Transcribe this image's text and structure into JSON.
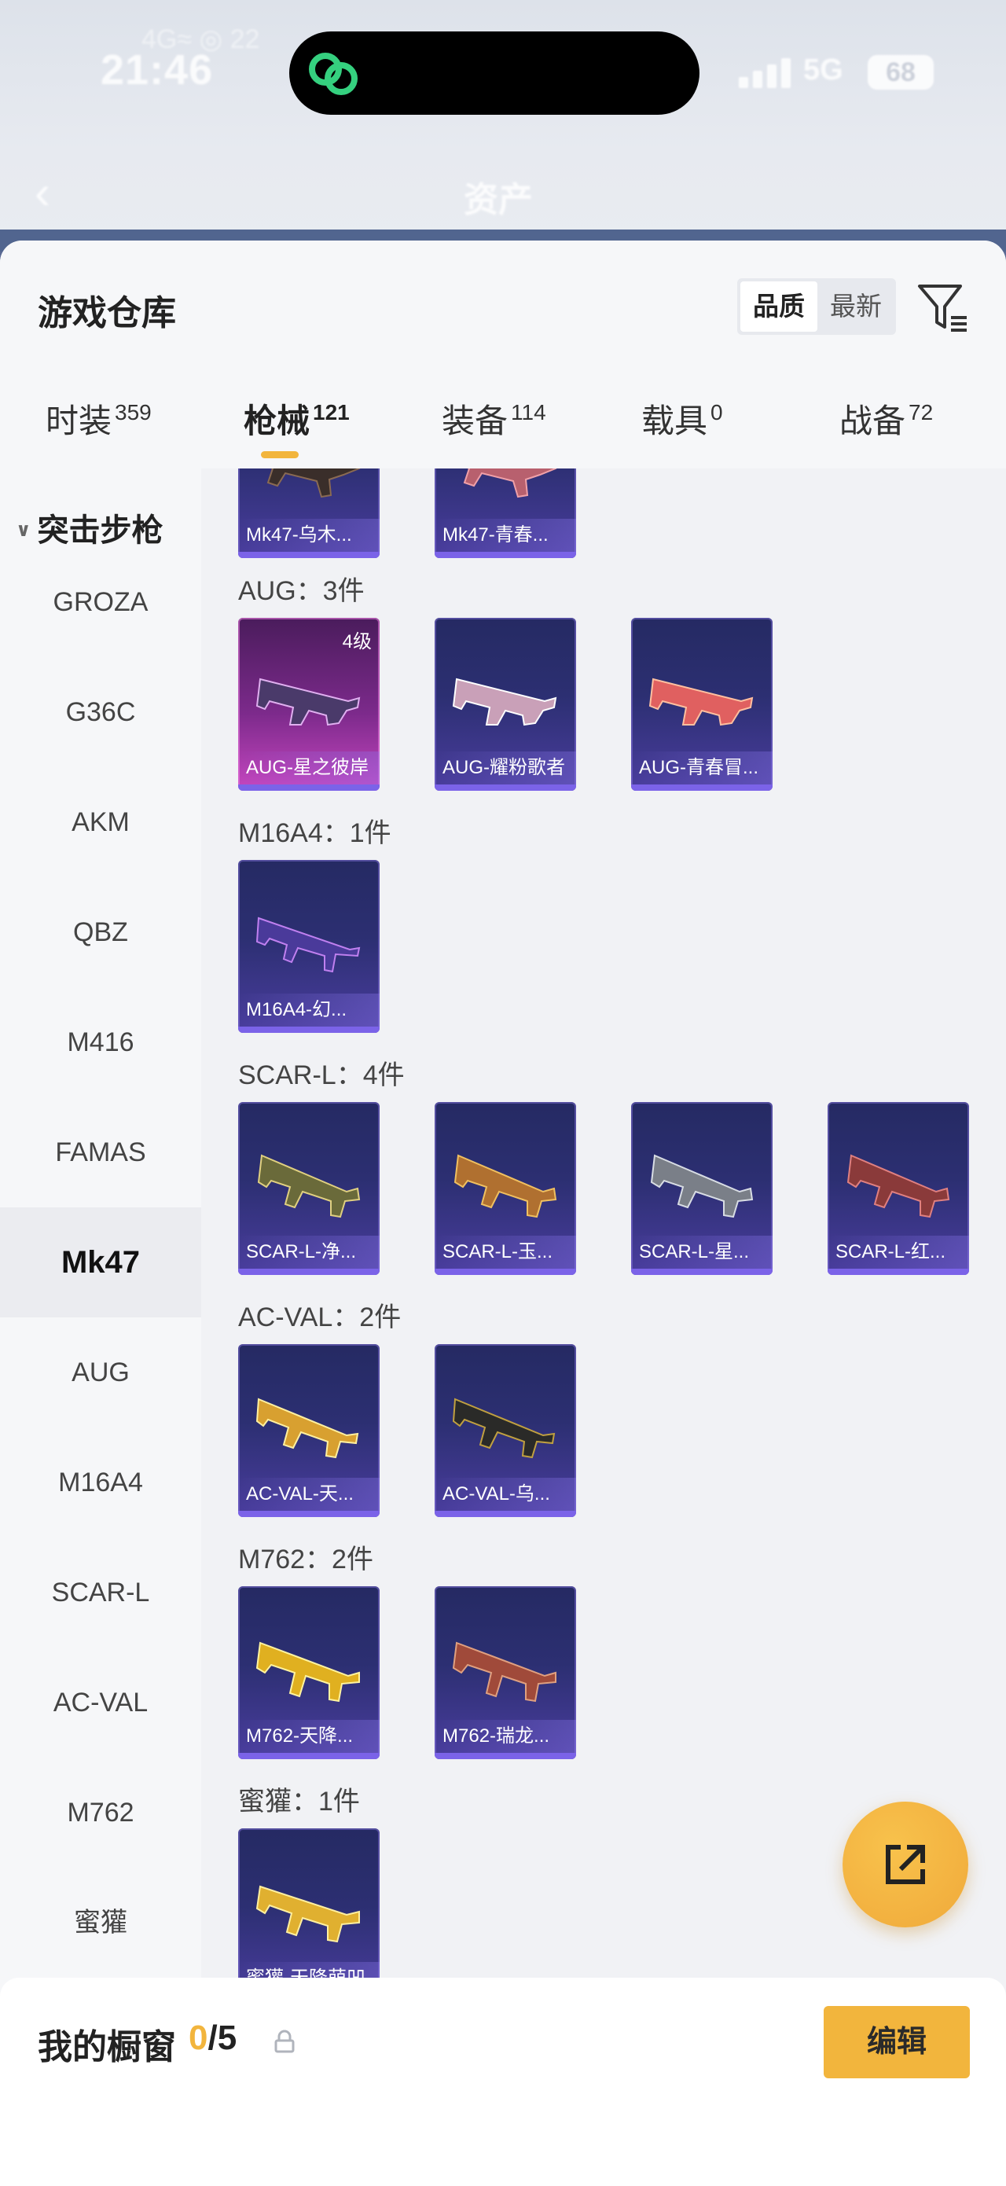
{
  "status_bar": {
    "time": "21:46",
    "carrier": "4G≈ ◎ 22",
    "network": "5G",
    "battery": "68"
  },
  "background_header": {
    "back": "‹",
    "title": "资产"
  },
  "sheet": {
    "title": "游戏仓库",
    "sort": {
      "quality": "品质",
      "newest": "最新"
    },
    "tabs": [
      {
        "label": "时装",
        "count": "359"
      },
      {
        "label": "枪械",
        "count": "121"
      },
      {
        "label": "装备",
        "count": "114"
      },
      {
        "label": "载具",
        "count": "0"
      },
      {
        "label": "战备",
        "count": "72"
      }
    ]
  },
  "sidebar": {
    "group": "突击步枪",
    "items": [
      "GROZA",
      "G36C",
      "AKM",
      "QBZ",
      "M416",
      "FAMAS",
      "Mk47",
      "AUG",
      "M16A4",
      "SCAR-L",
      "AC-VAL",
      "M762",
      "蜜獾"
    ],
    "active": "Mk47"
  },
  "groups": [
    {
      "title": "",
      "items": [
        {
          "name": "Mk47-乌木..."
        },
        {
          "name": "Mk47-青春..."
        }
      ]
    },
    {
      "title": "AUG：3件",
      "items": [
        {
          "name": "AUG-星之彼岸",
          "level": "4级"
        },
        {
          "name": "AUG-耀粉歌者"
        },
        {
          "name": "AUG-青春冒..."
        }
      ]
    },
    {
      "title": "M16A4：1件",
      "items": [
        {
          "name": "M16A4-幻..."
        }
      ]
    },
    {
      "title": "SCAR-L：4件",
      "items": [
        {
          "name": "SCAR-L-净..."
        },
        {
          "name": "SCAR-L-玉..."
        },
        {
          "name": "SCAR-L-星..."
        },
        {
          "name": "SCAR-L-红..."
        }
      ]
    },
    {
      "title": "AC-VAL：2件",
      "items": [
        {
          "name": "AC-VAL-天..."
        },
        {
          "name": "AC-VAL-乌..."
        }
      ]
    },
    {
      "title": "M762：2件",
      "items": [
        {
          "name": "M762-天降..."
        },
        {
          "name": "M762-瑞龙..."
        }
      ]
    },
    {
      "title": "蜜獾：1件",
      "items": [
        {
          "name": "蜜獾-天降萌凹"
        }
      ]
    }
  ],
  "bottom_bar": {
    "label": "我的橱窗",
    "used": "0",
    "total": "/5",
    "edit": "编辑"
  },
  "colors": {
    "accent": "#f2b53d",
    "card": "#2c2f72",
    "card_highlight": "#c746c0"
  },
  "icons": [
    "back-icon",
    "filter-icon",
    "lock-icon",
    "share-icon",
    "chevron-down-icon",
    "app-link-icon"
  ]
}
